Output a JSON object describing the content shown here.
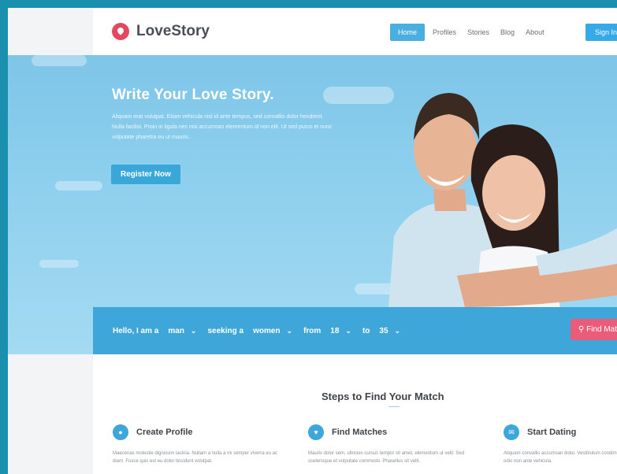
{
  "brand": {
    "name": "LoveStory"
  },
  "nav": {
    "items": [
      {
        "label": "Home",
        "active": true
      },
      {
        "label": "Profiles",
        "active": false
      },
      {
        "label": "Stories",
        "active": false
      },
      {
        "label": "Blog",
        "active": false
      },
      {
        "label": "About",
        "active": false
      }
    ],
    "signin_label": "Sign In"
  },
  "hero": {
    "title": "Write Your Love Story.",
    "body": "Aliquam erat volutpat. Etiam vehicula nisl id ante tempus, sed convallis dolor hendrerit. Nulla facilisi. Proin in ligula nec nisi accumsan elementum id non elit. Ut sed purus et nunc vulputate pharetra eu ut mauris.",
    "register_label": "Register Now"
  },
  "search": {
    "intro": "Hello, I am a",
    "gender": "man",
    "seeking_label": "seeking a",
    "seeking": "women",
    "from_label": "from",
    "age_from": "18",
    "to_label": "to",
    "age_to": "35",
    "find_label": "Find Match"
  },
  "steps": {
    "title": "Steps to Find Your Match",
    "items": [
      {
        "title": "Create Profile",
        "icon": "user-icon",
        "text": "Maecenas molestie dignissim lacinia. Nullam a nulla a mi semper viverra eu ac diam. Fusce quis est eu dolor tincidunt volutpat."
      },
      {
        "title": "Find Matches",
        "icon": "heart-icon",
        "text": "Mauris dolor sem, ultricies cursus tempor sit amet, elementum ut velit. Sed scelerisque et vulputate commodo. Phasellus sit velit."
      },
      {
        "title": "Start Dating",
        "icon": "chat-icon",
        "text": "Aliquam convallis accumsan dolor. Vestibulum condimentum, erat vulputate odio non ante vehicula."
      }
    ]
  },
  "colors": {
    "accent": "#3ea6d8",
    "brand": "#e4485f",
    "find_button": "#ea5c7a"
  }
}
